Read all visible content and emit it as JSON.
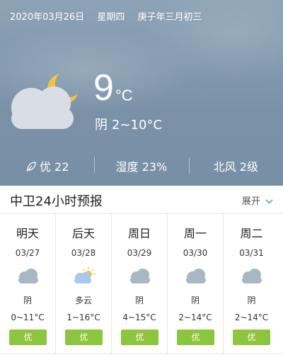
{
  "header": {
    "date": "2020年03月26日",
    "weekday": "星期四",
    "lunar": "庚子年三月初三"
  },
  "current": {
    "icon": "cloud-moon-icon",
    "temperature": "9",
    "unit": "°C",
    "condition": "阴",
    "range": "2~10°C"
  },
  "stats": {
    "aqi": "优 22",
    "humidity": "湿度 23%",
    "wind": "北风 2级"
  },
  "forecast_section": {
    "title": "中卫24小时预报",
    "expand_label": "展开"
  },
  "days": [
    {
      "name": "明天",
      "date": "03/27",
      "icon": "cloud-icon",
      "condition": "阴",
      "temp": "0~11°C",
      "aqi": "优"
    },
    {
      "name": "后天",
      "date": "03/28",
      "icon": "partly-cloudy-icon",
      "condition": "多云",
      "temp": "1~16°C",
      "aqi": "优"
    },
    {
      "name": "周日",
      "date": "03/29",
      "icon": "cloud-icon",
      "condition": "阴",
      "temp": "4~15°C",
      "aqi": "优"
    },
    {
      "name": "周一",
      "date": "03/30",
      "icon": "cloud-icon",
      "condition": "阴",
      "temp": "2~14°C",
      "aqi": "优"
    },
    {
      "name": "周二",
      "date": "03/31",
      "icon": "cloud-icon",
      "condition": "阴",
      "temp": "2~14°C",
      "aqi": "优"
    }
  ],
  "colors": {
    "sky": "#8299ae",
    "aqi_good": "#8cc63f",
    "sun": "#f5c242",
    "cloud_small": "#a9b6c6"
  }
}
